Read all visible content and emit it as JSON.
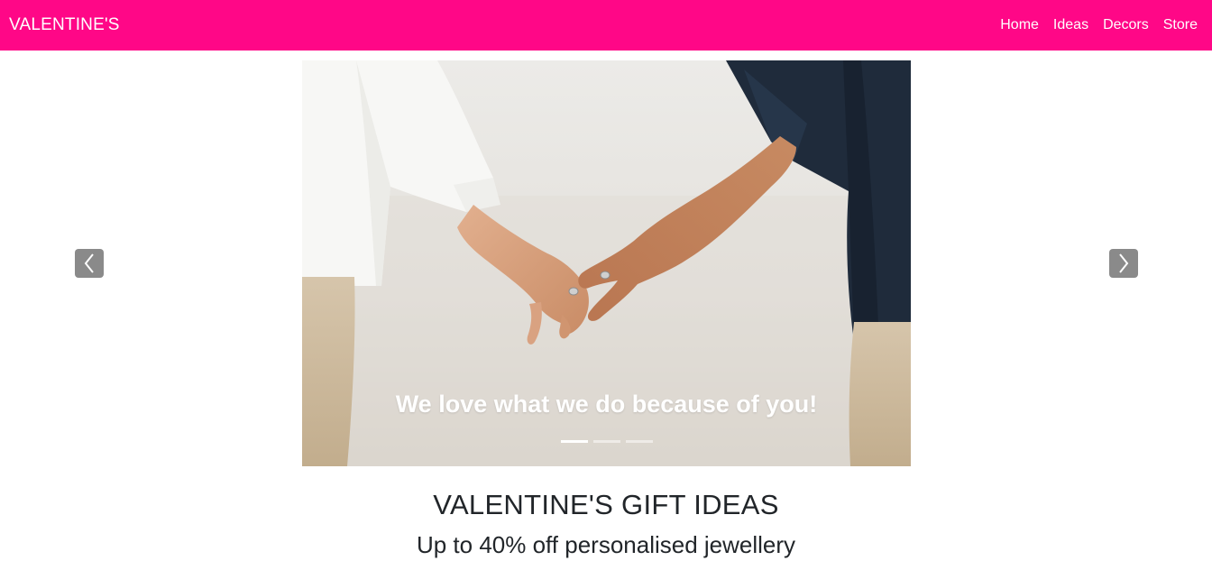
{
  "navbar": {
    "brand": "VALENTINE'S",
    "links": [
      "Home",
      "Ideas",
      "Decors",
      "Store"
    ],
    "color": "#ff0787"
  },
  "carousel": {
    "caption": "We love what we do because of you!",
    "slides": 3,
    "active_slide": 1,
    "prev_icon": "chevron-left-icon",
    "next_icon": "chevron-right-icon"
  },
  "content": {
    "title": "VALENTINE'S GIFT IDEAS",
    "subtitle": "Up to 40% off personalised jewellery"
  }
}
